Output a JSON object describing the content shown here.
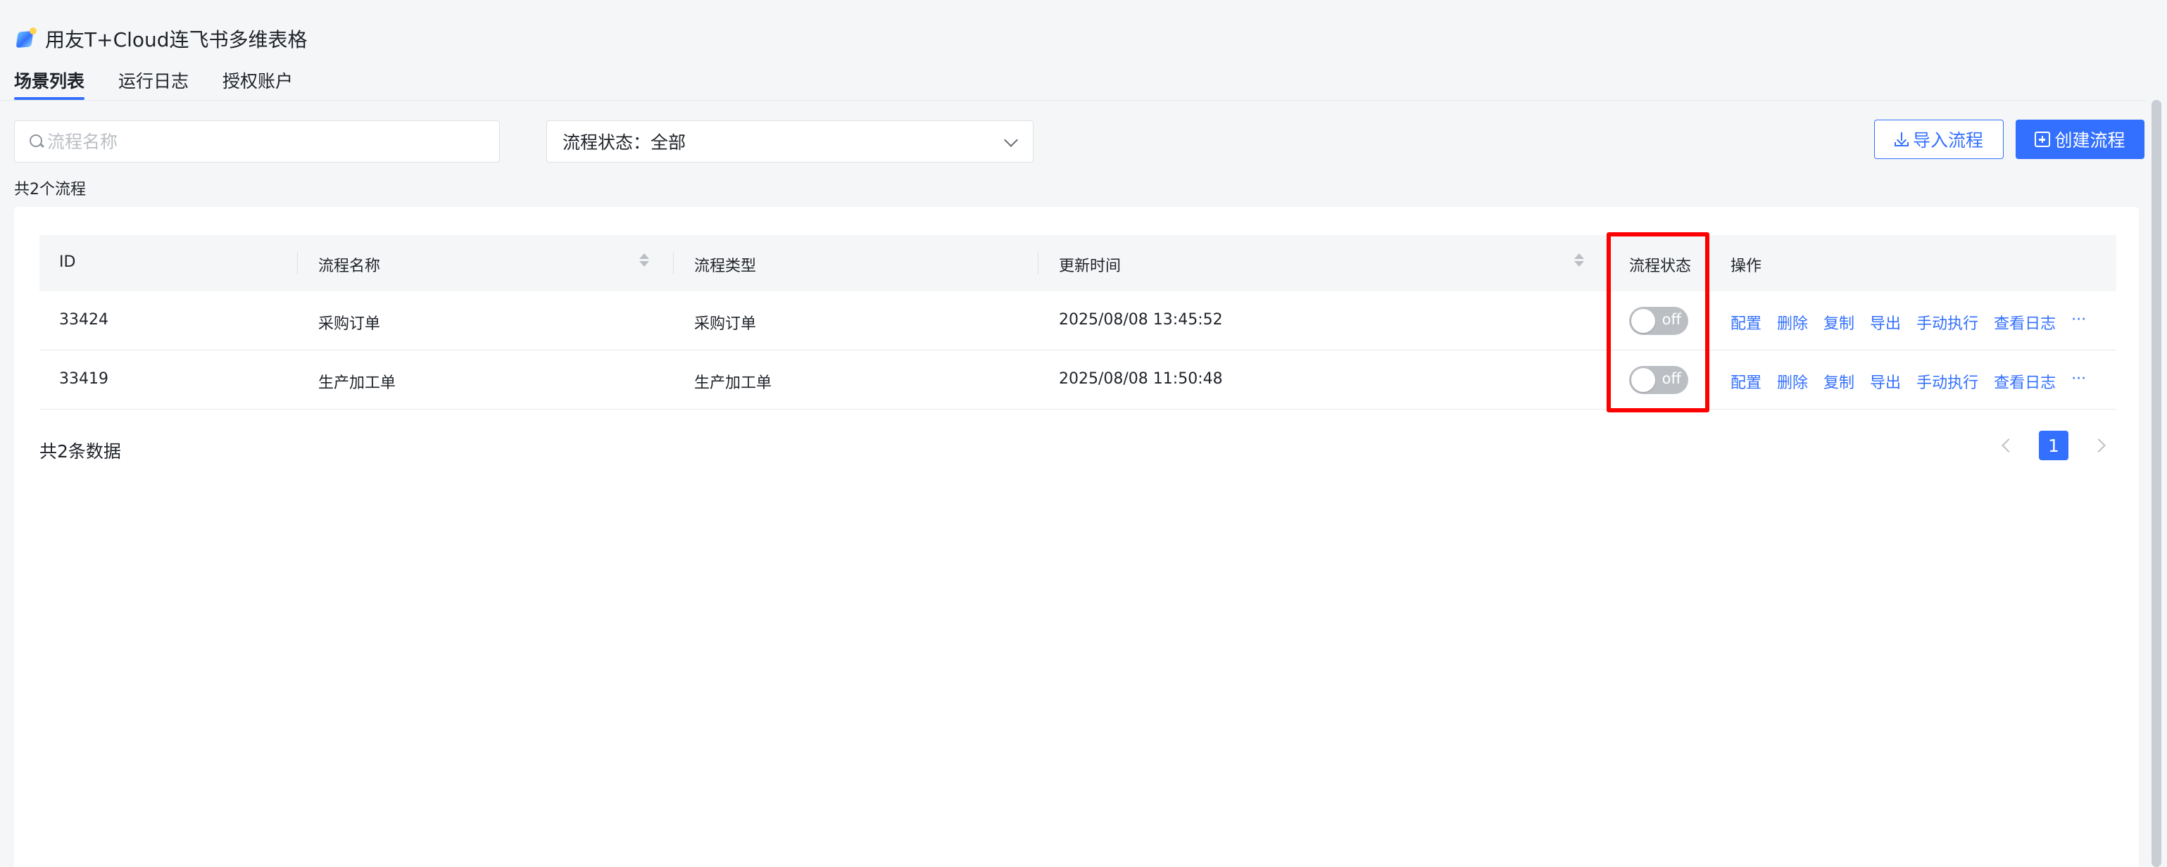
{
  "app": {
    "title": "用友T+Cloud连飞书多维表格"
  },
  "tabs": [
    {
      "label": "场景列表",
      "active": true
    },
    {
      "label": "运行日志",
      "active": false
    },
    {
      "label": "授权账户",
      "active": false
    }
  ],
  "toolbar": {
    "search_placeholder": "流程名称",
    "status_filter": "流程状态：全部",
    "import_label": "导入流程",
    "create_label": "创建流程"
  },
  "flow_count": "共2个流程",
  "table": {
    "headers": {
      "id": "ID",
      "name": "流程名称",
      "type": "流程类型",
      "updated": "更新时间",
      "status": "流程状态",
      "ops": "操作"
    },
    "rows": [
      {
        "id": "33424",
        "name": "采购订单",
        "type": "采购订单",
        "updated": "2025/08/08 13:45:52",
        "status": "off"
      },
      {
        "id": "33419",
        "name": "生产加工单",
        "type": "生产加工单",
        "updated": "2025/08/08 11:50:48",
        "status": "off"
      }
    ],
    "actions": [
      "配置",
      "删除",
      "复制",
      "导出",
      "手动执行",
      "查看日志",
      "···"
    ]
  },
  "footer": {
    "total": "共2条数据",
    "current_page": "1"
  },
  "colors": {
    "accent": "#3370ff",
    "highlight": "#ff0000",
    "switch_off": "#bbbfc4"
  }
}
